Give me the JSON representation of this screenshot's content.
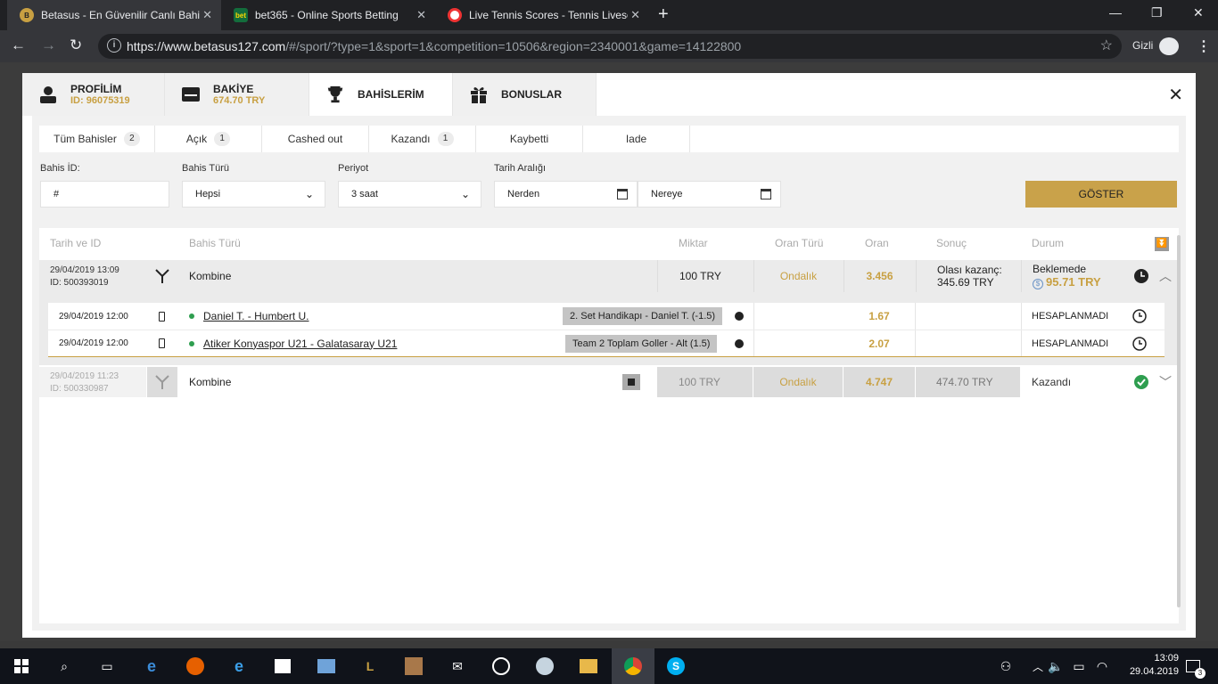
{
  "browser": {
    "tabs": [
      {
        "title": "Betasus - En Güvenilir Canlı Bahis",
        "icon": "betasus-favicon",
        "active": true
      },
      {
        "title": "bet365 - Online Sports Betting",
        "icon": "bet365-favicon",
        "active": false
      },
      {
        "title": "Live Tennis Scores - Tennis Livesco",
        "icon": "tennis-favicon",
        "active": false
      }
    ],
    "url_domain": "https://www.betasus127.com",
    "url_path": "/#/sport/?type=1&sport=1&competition=10506&region=2340001&game=14122800",
    "incognito_label": "Gizli"
  },
  "modal": {
    "tabs": [
      {
        "label": "PROFİLİM",
        "sub": "ID: 96075319",
        "icon": "user-icon"
      },
      {
        "label": "BAKİYE",
        "sub": "674.70 TRY",
        "icon": "wallet-icon"
      },
      {
        "label": "BAHİSLERİM",
        "sub": "",
        "icon": "trophy-icon"
      },
      {
        "label": "BONUSLAR",
        "sub": "",
        "icon": "gift-icon"
      }
    ],
    "filter_tabs": [
      {
        "label": "Tüm Bahisler",
        "count": "2"
      },
      {
        "label": "Açık",
        "count": "1"
      },
      {
        "label": "Cashed out",
        "count": ""
      },
      {
        "label": "Kazandı",
        "count": "1"
      },
      {
        "label": "Kaybetti",
        "count": ""
      },
      {
        "label": "Iade",
        "count": ""
      }
    ],
    "filters": {
      "bet_id_label": "Bahis İD:",
      "bet_id_value": "#",
      "bet_type_label": "Bahis Türü",
      "bet_type_value": "Hepsi",
      "period_label": "Periyot",
      "period_value": "3 saat",
      "date_range_label": "Tarih Aralığı",
      "from_placeholder": "Nerden",
      "to_placeholder": "Nereye",
      "show_button": "GÖSTER"
    },
    "table_headers": {
      "date_id": "Tarih ve ID",
      "bet_type": "Bahis Türü",
      "amount": "Miktar",
      "odds_type": "Oran Türü",
      "odds": "Oran",
      "result": "Sonuç",
      "status": "Durum"
    },
    "bets": [
      {
        "date": "29/04/2019 13:09",
        "id": "ID: 500393019",
        "type": "Kombine",
        "amount": "100 TRY",
        "odds_type": "Ondalık",
        "odds": "3.456",
        "result_label": "Olası kazanç:",
        "result_value": "345.69 TRY",
        "status": "Beklemede",
        "status_amount": "95.71 TRY",
        "selections": [
          {
            "date": "29/04/2019 12:00",
            "match": "Daniel T. - Humbert U.",
            "market": "2. Set Handikapı - Daniel T. (-1.5)",
            "odds": "1.67",
            "status": "HESAPLANMADI"
          },
          {
            "date": "29/04/2019 12:00",
            "match": "Atiker Konyaspor U21 - Galatasaray U21",
            "market": "Team 2 Toplam Goller - Alt (1.5)",
            "odds": "2.07",
            "status": "HESAPLANMADI"
          }
        ]
      },
      {
        "date": "29/04/2019 11:23",
        "id": "ID: 500330987",
        "type": "Kombine",
        "amount": "100 TRY",
        "odds_type": "Ondalık",
        "odds": "4.747",
        "result_value": "474.70 TRY",
        "status": "Kazandı"
      }
    ]
  },
  "taskbar": {
    "time": "13:09",
    "date": "29.04.2019",
    "notification_count": "3"
  },
  "colors": {
    "accent_gold": "#c9a24a",
    "won_green": "#2e9e4f",
    "browser_dark": "#202124"
  }
}
